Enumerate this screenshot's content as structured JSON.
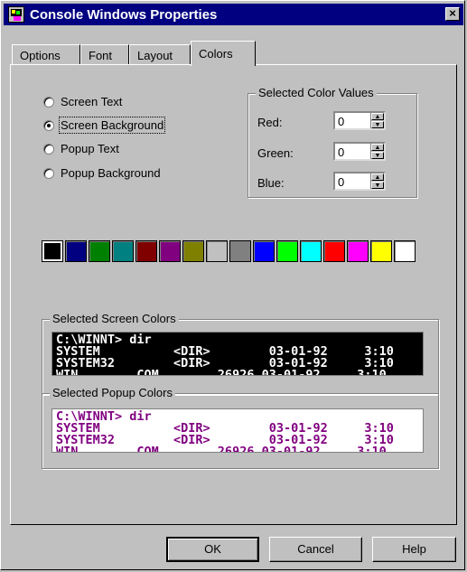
{
  "window": {
    "title": "Console Windows Properties",
    "close_glyph": "×",
    "icon": "console-app-icon"
  },
  "tabs": [
    {
      "label": "Options",
      "active": false
    },
    {
      "label": "Font",
      "active": false
    },
    {
      "label": "Layout",
      "active": false
    },
    {
      "label": "Colors",
      "active": true
    }
  ],
  "colors_tab": {
    "radios": [
      {
        "label": "Screen Text",
        "selected": false
      },
      {
        "label": "Screen Background",
        "selected": true
      },
      {
        "label": "Popup Text",
        "selected": false
      },
      {
        "label": "Popup Background",
        "selected": false
      }
    ],
    "color_values": {
      "title": "Selected Color Values",
      "red_label": "Red:",
      "green_label": "Green:",
      "blue_label": "Blue:",
      "red": "0",
      "green": "0",
      "blue": "0"
    },
    "palette": [
      "#000000",
      "#000080",
      "#008000",
      "#008080",
      "#800000",
      "#800080",
      "#808000",
      "#c0c0c0",
      "#808080",
      "#0000ff",
      "#00ff00",
      "#00ffff",
      "#ff0000",
      "#ff00ff",
      "#ffff00",
      "#ffffff"
    ],
    "selected_palette_index": 0,
    "screen_preview": {
      "title": "Selected Screen Colors",
      "text": "C:\\WINNT> dir\nSYSTEM          <DIR>        03-01-92     3:10\nSYSTEM32        <DIR>        03-01-92     3:10\nWIN        COM        26926 03-01-92     3:10",
      "fg": "#ffffff",
      "bg": "#000000"
    },
    "popup_preview": {
      "title": "Selected Popup Colors",
      "text": "C:\\WINNT> dir\nSYSTEM          <DIR>        03-01-92     3:10\nSYSTEM32        <DIR>        03-01-92     3:10\nWIN        COM        26926 03-01-92     3:10",
      "fg": "#800080",
      "bg": "#ffffff"
    }
  },
  "buttons": {
    "ok": "OK",
    "cancel": "Cancel",
    "help": "Help"
  }
}
